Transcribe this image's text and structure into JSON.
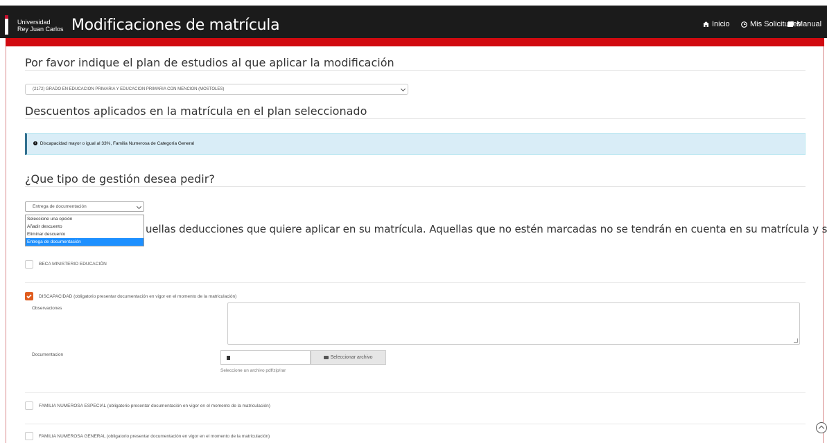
{
  "header": {
    "logo_line1": "Universidad",
    "logo_line2": "Rey Juan Carlos",
    "title": "Modificaciones de matrícula",
    "nav": [
      {
        "label": "Inicio",
        "icon": "home-icon"
      },
      {
        "label": "Mis Solicitudes",
        "icon": "solicitudes-icon"
      },
      {
        "label": "Manual",
        "icon": "book-icon"
      }
    ]
  },
  "plan_section": {
    "heading": "Por favor indique el plan de estudios al que aplicar la modificación",
    "selected_plan": "(2172) GRADO EN EDUCACION PRIMARIA Y EDUCACION PRIMARIA CON MENCION (MOSTOLES)"
  },
  "discounts_section": {
    "heading": "Descuentos aplicados en la matrícula en el plan seleccionado",
    "info": "Discapacidad mayor o igual al 33%, Familia Numerosa de Categoría General"
  },
  "gestion_section": {
    "heading": "¿Que tipo de gestión desea pedir?",
    "selected": "Entrega de documentación",
    "options": [
      "Seleccione una opción",
      "Añadir descuento",
      "Eliminar descuento",
      "Entrega de documentación"
    ],
    "highlighted_index": 3
  },
  "deductions_text": "uellas deducciones que quiere aplicar en su matrícula. Aquellas que no estén marcadas no se tendrán en cuenta en su matrícula y se",
  "deductions": [
    {
      "label": "BECA MINISTERIO EDUCACIÓN",
      "checked": false
    },
    {
      "label": "DISCAPACIDAD (obligatorio presentar documentación en vigor en el momento de la matriculación)",
      "checked": true
    },
    {
      "label": "FAMILIA NUMEROSA ESPECIAL (obligatorio presentar documentación en vigor en el momento de la matriculación)",
      "checked": false
    },
    {
      "label": "FAMILIA NUMEROSA GENERAL (obligatorio presentar documentación en vigor en el momento de la matriculación)",
      "checked": false
    }
  ],
  "form": {
    "observaciones_label": "Observaciones",
    "documentacion_label": "Documentacion",
    "file_button": "Seleccionar archivo",
    "file_help": "Seleccione un archivo pdf/zip/rar"
  },
  "colors": {
    "accent": "#d10a10",
    "checkbox_checked": "#e05c1e",
    "dropdown_highlight": "#1e90ff"
  }
}
